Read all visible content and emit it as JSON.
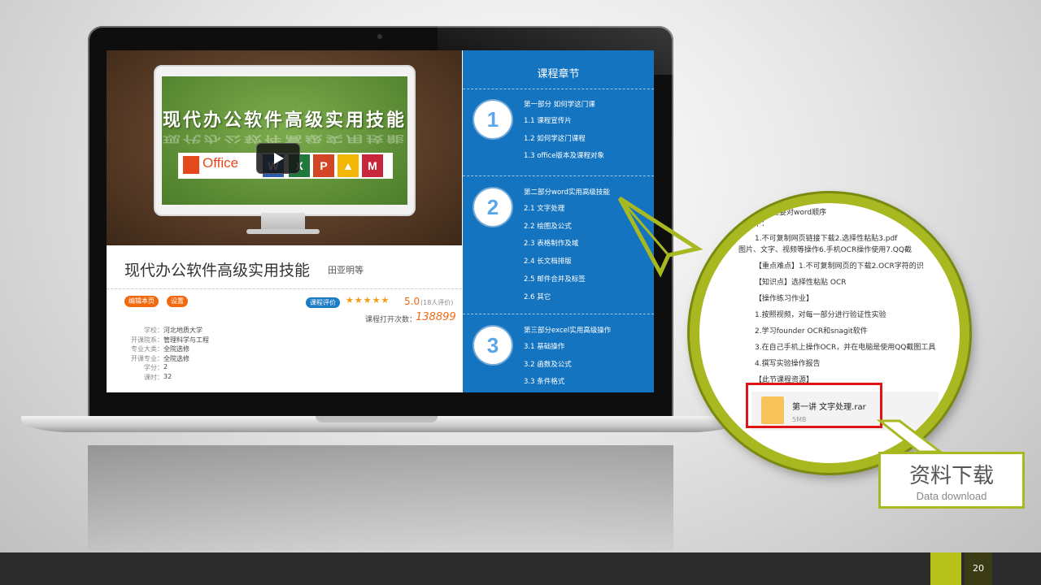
{
  "monitor": {
    "title": "现代办公软件高级实用技能",
    "office_label": "Office",
    "app_icons": [
      {
        "name": "word-icon",
        "letter": "W",
        "color": "#2a5caa"
      },
      {
        "name": "excel-icon",
        "letter": "X",
        "color": "#1d7a3a"
      },
      {
        "name": "powerpoint-icon",
        "letter": "P",
        "color": "#d24626"
      },
      {
        "name": "tool-icon",
        "letter": "▲",
        "color": "#f2b705"
      },
      {
        "name": "mindmanager-icon",
        "letter": "M",
        "color": "#c8263a"
      }
    ]
  },
  "course": {
    "title": "现代办公软件高级实用技能",
    "author": "田亚明等",
    "buttons": [
      "编辑本页",
      "设置"
    ],
    "rating_tag": "课程评价",
    "stars": "★★★★★",
    "score": "5.0",
    "rating_count": "(18人评价)",
    "open_label": "课程打开次数：",
    "open_count": "138899",
    "info": [
      {
        "label": "学校：",
        "value": "河北地质大学"
      },
      {
        "label": "开课院系：",
        "value": "管理科学与工程"
      },
      {
        "label": "专业大类：",
        "value": "全院选修"
      },
      {
        "label": "开课专业：",
        "value": "全院选修"
      },
      {
        "label": "学分：",
        "value": "2"
      },
      {
        "label": "课时：",
        "value": "32"
      }
    ]
  },
  "chapters": {
    "title": "课程章节",
    "parts": [
      {
        "num": "1",
        "title": "第一部分 如何学这门课",
        "items": [
          "1.1  课程宣传片",
          "1.2  如何学这门课程",
          "1.3  office版本及课程对象"
        ]
      },
      {
        "num": "2",
        "title": "第二部分word实用高级技能",
        "items": [
          "2.1  文字处理",
          "2.2  绘图及公式",
          "2.3  表格制作及域",
          "2.4  长文档排版",
          "2.5  邮件合并及标签",
          "2.6  其它"
        ]
      },
      {
        "num": "3",
        "title": "第三部分excel实用高级操作",
        "items": [
          "3.1  基础操作",
          "3.2  函数及公式",
          "3.3  条件格式"
        ]
      }
    ]
  },
  "magnifier": {
    "lines": [
      "】本节主要对word顺序",
      "如下：",
      "1.不可复制网页链接下载2.选择性粘贴3.pdf",
      "图片、文字、视频等操作6.手机OCR操作使用7.QQ截",
      "【重点难点】1.不可复制网页的下载2.OCR字符的识",
      "【知识点】选择性粘贴  OCR",
      "【操作练习作业】",
      "1.按照视频，对每一部分进行验证性实验",
      "2.学习founder OCR和snagit软件",
      "3.在自己手机上操作OCR，并在电脑是使用QQ截图工具",
      "4.撰写实验操作报告",
      "【此节课程资源】"
    ],
    "file_name": "第一讲 文字处理.rar",
    "file_size": "5MB"
  },
  "label": {
    "title": "资料下载",
    "subtitle": "Data download"
  },
  "footer": {
    "page": "20"
  },
  "colors": {
    "accent": "#a8b820",
    "panel": "#1474c0",
    "orange": "#f26a10",
    "highlight": "#e01414"
  }
}
